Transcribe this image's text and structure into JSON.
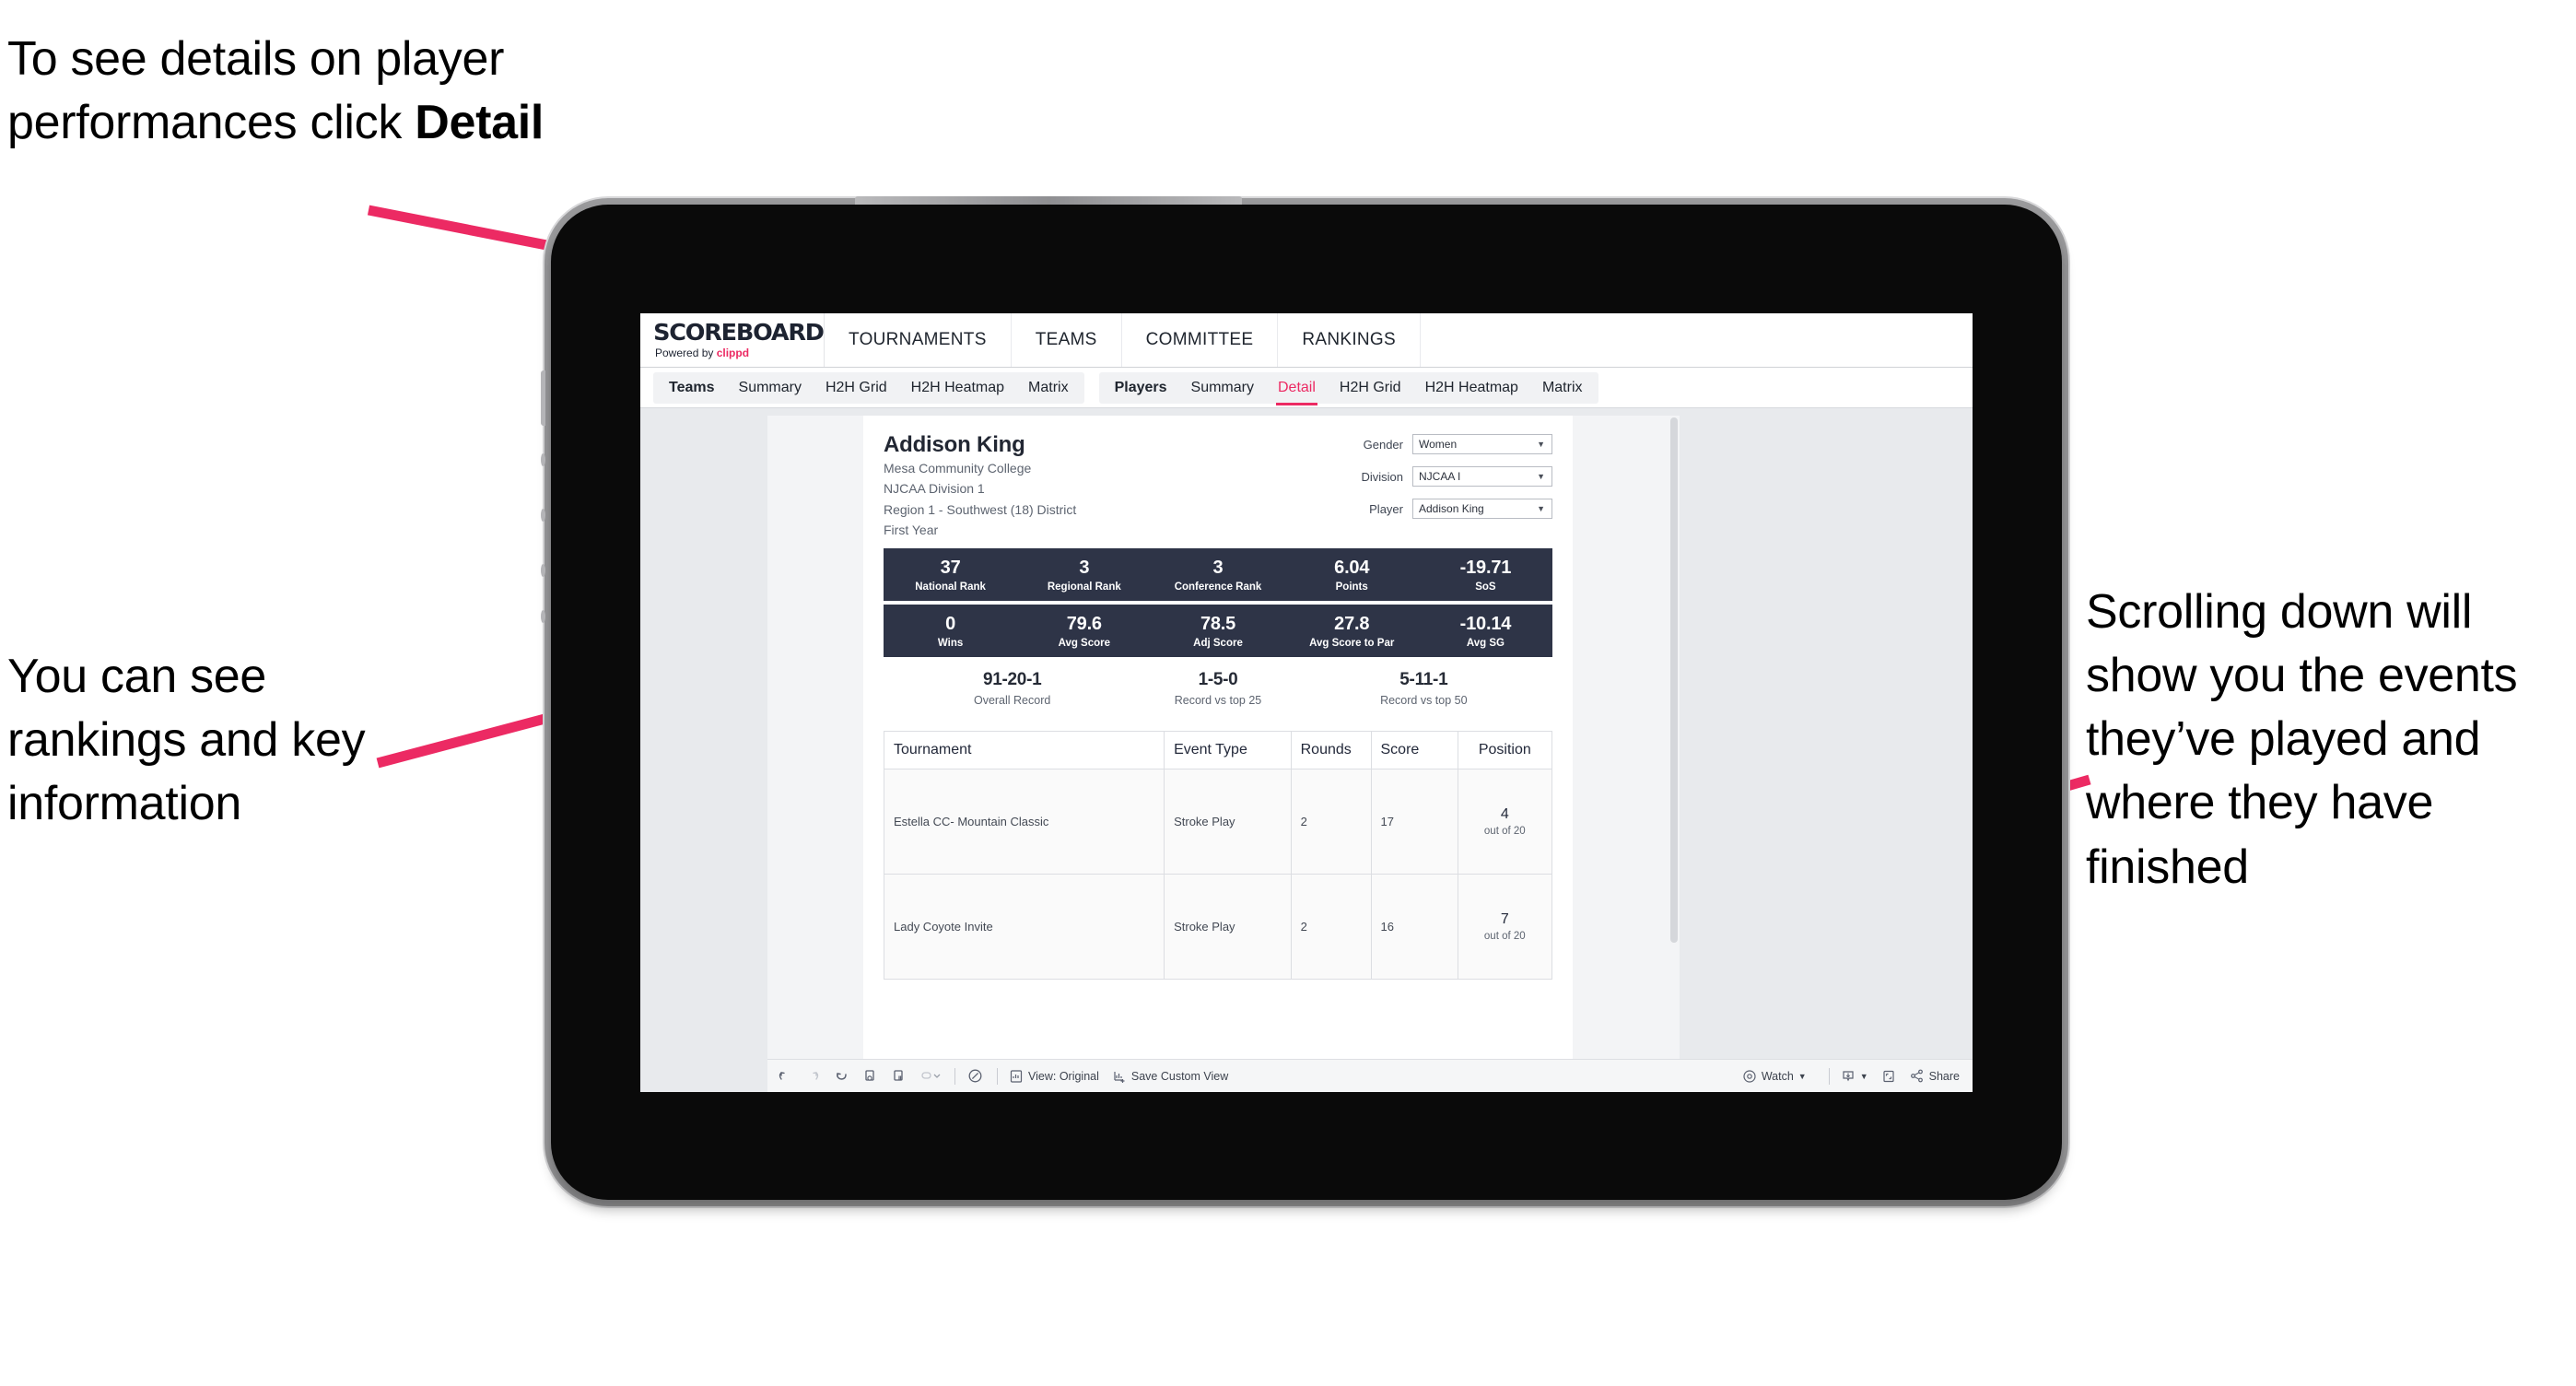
{
  "annotations": {
    "detail": "To see details on player performances click ",
    "detail_bold": "Detail",
    "rankings": "You can see rankings and key information",
    "scroll": "Scrolling down will show you the events they’ve played and where they have finished"
  },
  "colors": {
    "accent_pink": "#ec2a63",
    "stat_navy": "#2e3447",
    "screen_bg": "#e8eaed",
    "device_body": "#0a0a0a"
  },
  "app": {
    "brand": {
      "title": "SCOREBOARD",
      "powered_prefix": "Powered by ",
      "powered_brand": "clippd"
    },
    "top_nav": [
      {
        "label": "TOURNAMENTS"
      },
      {
        "label": "TEAMS"
      },
      {
        "label": "COMMITTEE"
      },
      {
        "label": "RANKINGS"
      }
    ],
    "tab_groups": [
      {
        "head": "Teams",
        "tabs": [
          {
            "label": "Summary",
            "active": false
          },
          {
            "label": "H2H Grid",
            "active": false
          },
          {
            "label": "H2H Heatmap",
            "active": false
          },
          {
            "label": "Matrix",
            "active": false
          }
        ]
      },
      {
        "head": "Players",
        "tabs": [
          {
            "label": "Summary",
            "active": false
          },
          {
            "label": "Detail",
            "active": true
          },
          {
            "label": "H2H Grid",
            "active": false
          },
          {
            "label": "H2H Heatmap",
            "active": false
          },
          {
            "label": "Matrix",
            "active": false
          }
        ]
      }
    ]
  },
  "player": {
    "name": "Addison King",
    "school": "Mesa Community College",
    "division": "NJCAA Division 1",
    "region": "Region 1 - Southwest (18) District",
    "year": "First Year"
  },
  "filters": [
    {
      "label": "Gender",
      "value": "Women"
    },
    {
      "label": "Division",
      "value": "NJCAA I"
    },
    {
      "label": "Player",
      "value": "Addison King"
    }
  ],
  "stats_row1": [
    {
      "value": "37",
      "label": "National Rank"
    },
    {
      "value": "3",
      "label": "Regional Rank"
    },
    {
      "value": "3",
      "label": "Conference Rank"
    },
    {
      "value": "6.04",
      "label": "Points"
    },
    {
      "value": "-19.71",
      "label": "SoS"
    }
  ],
  "stats_row2": [
    {
      "value": "0",
      "label": "Wins"
    },
    {
      "value": "79.6",
      "label": "Avg Score"
    },
    {
      "value": "78.5",
      "label": "Adj Score"
    },
    {
      "value": "27.8",
      "label": "Avg Score to Par"
    },
    {
      "value": "-10.14",
      "label": "Avg SG"
    }
  ],
  "records": [
    {
      "value": "91-20-1",
      "label": "Overall Record"
    },
    {
      "value": "1-5-0",
      "label": "Record vs top 25"
    },
    {
      "value": "5-11-1",
      "label": "Record vs top 50"
    }
  ],
  "table": {
    "headers": [
      "Tournament",
      "Event Type",
      "Rounds",
      "Score",
      "Position"
    ],
    "rows": [
      {
        "tournament": "Estella CC- Mountain Classic",
        "event_type": "Stroke Play",
        "rounds": "2",
        "score": "17",
        "position_value": "4",
        "position_out_of": "out of 20"
      },
      {
        "tournament": "Lady Coyote Invite",
        "event_type": "Stroke Play",
        "rounds": "2",
        "score": "16",
        "position_value": "7",
        "position_out_of": "out of 20"
      }
    ]
  },
  "toolbar": {
    "view_label": "View: Original",
    "save_label": "Save Custom View",
    "watch_label": "Watch",
    "share_label": "Share"
  }
}
